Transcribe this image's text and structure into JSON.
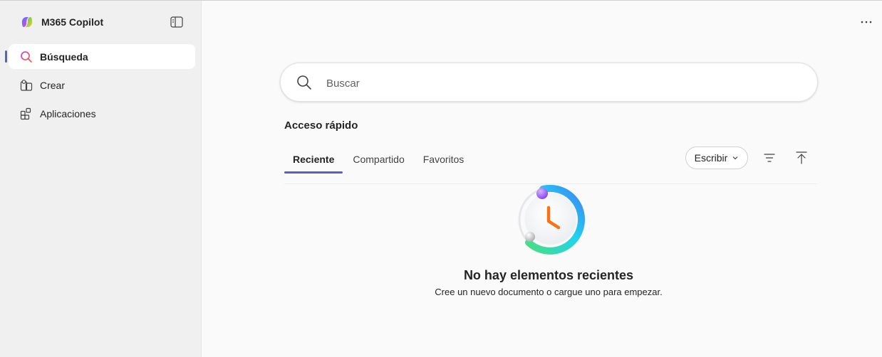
{
  "app": {
    "title": "M365 Copilot"
  },
  "sidebar": {
    "items": [
      {
        "label": "Búsqueda",
        "icon": "search-icon",
        "active": true
      },
      {
        "label": "Crear",
        "icon": "create-icon",
        "active": false
      },
      {
        "label": "Aplicaciones",
        "icon": "apps-icon",
        "active": false
      }
    ]
  },
  "search": {
    "placeholder": "Buscar"
  },
  "quick_access": {
    "title": "Acceso rápido",
    "tabs": [
      {
        "label": "Reciente",
        "active": true
      },
      {
        "label": "Compartido",
        "active": false
      },
      {
        "label": "Favoritos",
        "active": false
      }
    ],
    "write_label": "Escribir"
  },
  "empty_state": {
    "title": "No hay elementos recientes",
    "subtitle": "Cree un nuevo documento o cargue uno para empezar."
  },
  "colors": {
    "accent": "#5b5fc7",
    "sidebar_bg": "#f0f0f0",
    "main_bg": "#fafafa"
  }
}
